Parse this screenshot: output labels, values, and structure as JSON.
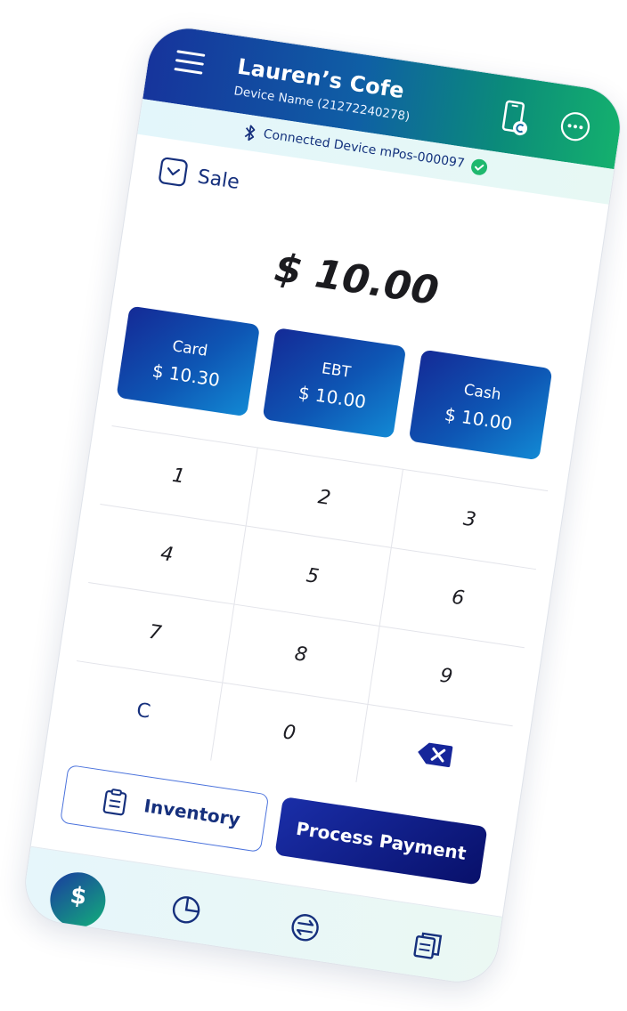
{
  "header": {
    "store_name": "Lauren’s Cofe",
    "device_name": "Device Name (21272240278)"
  },
  "connection": {
    "text": "Connected Device mPos-000097"
  },
  "mode": {
    "label": "Sale"
  },
  "amount": "$ 10.00",
  "tenders": [
    {
      "label": "Card",
      "value": "$ 10.30"
    },
    {
      "label": "EBT",
      "value": "$ 10.00"
    },
    {
      "label": "Cash",
      "value": "$ 10.00"
    }
  ],
  "keypad": {
    "keys": [
      "1",
      "2",
      "3",
      "4",
      "5",
      "6",
      "7",
      "8",
      "9",
      "C",
      "0"
    ]
  },
  "actions": {
    "inventory_label": "Inventory",
    "process_label": "Process Payment"
  },
  "bottom_nav": {
    "pay_symbol": "$"
  },
  "colors": {
    "brand_blue": "#16307d",
    "accent_green": "#14b06e",
    "tile_gradient_start": "#142a96",
    "tile_gradient_end": "#1289d4"
  },
  "icons": [
    "menu-icon",
    "device-icon",
    "more-icon",
    "bluetooth-icon",
    "check-icon",
    "chevron-down-icon",
    "backspace-icon",
    "clipboard-icon",
    "dollar-icon",
    "pie-chart-icon",
    "transfer-icon",
    "history-icon"
  ]
}
